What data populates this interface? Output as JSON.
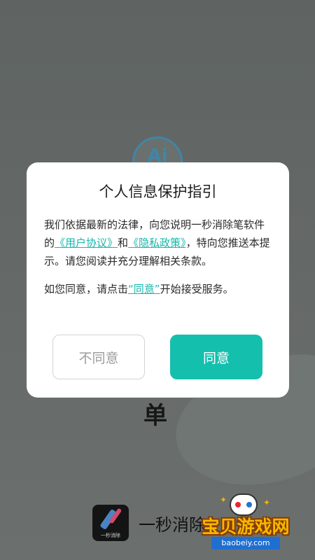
{
  "background": {
    "logo_text": "Ai",
    "partial_title_char": "单",
    "app_name": "一秒消除",
    "app_icon_caption": "一秒消除"
  },
  "dialog": {
    "title": "个人信息保护指引",
    "p1_part1": "我们依据最新的法律，向您说明一秒消除笔软件的",
    "user_agreement_link": "《用户协议》",
    "and": "和",
    "privacy_policy_link": "《隐私政策》",
    "p1_part2": "，特向您推送本提示。请您阅读并充分理解相关条款。",
    "p2_part1": "如您同意，请点击",
    "agree_link": "“同意”",
    "p2_part2": "开始接受服务。",
    "disagree_button": "不同意",
    "agree_button": "同意"
  },
  "watermark": {
    "text": "宝贝游戏网",
    "url": "baobeiy.com"
  },
  "colors": {
    "accent": "#15bfae",
    "overlay": "#5f6462",
    "watermark_yellow": "#f5b800"
  }
}
